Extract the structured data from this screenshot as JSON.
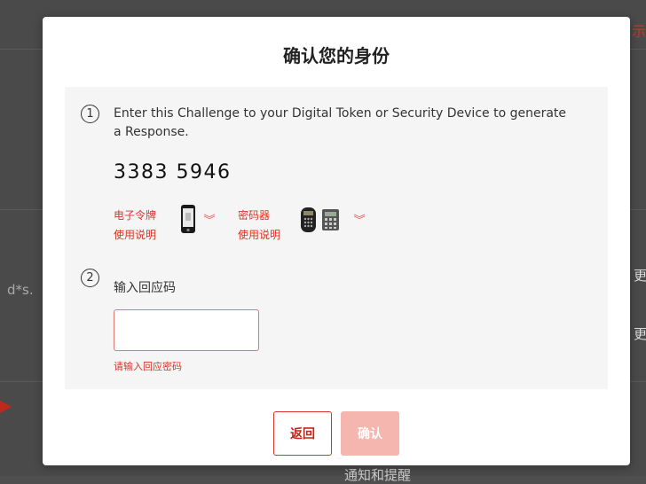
{
  "modal": {
    "title": "确认您的身份",
    "step1": {
      "number": "1",
      "text": "Enter this Challenge to your Digital Token or Security Device to generate a Response.",
      "challenge": "3383 5946",
      "guides": [
        {
          "line1": "电子令牌",
          "line2": "使用说明",
          "icon": "mobile-phone-icon"
        },
        {
          "line1": "密码器",
          "line2": "使用说明",
          "icon": "security-device-icon"
        }
      ]
    },
    "step2": {
      "number": "2",
      "label": "输入回应码",
      "input_value": "",
      "error": "请输入回应密码"
    },
    "buttons": {
      "back": "返回",
      "confirm": "确认"
    }
  },
  "background": {
    "fragment_left": "d*s.",
    "fragment_right_1": "更",
    "fragment_right_2": "更",
    "fragment_top": "示",
    "fragment_bottom": "通知和提醒"
  },
  "colors": {
    "accent": "#d9342b",
    "confirm_disabled": "#f6b6b0",
    "panel": "#f5f5f5"
  }
}
